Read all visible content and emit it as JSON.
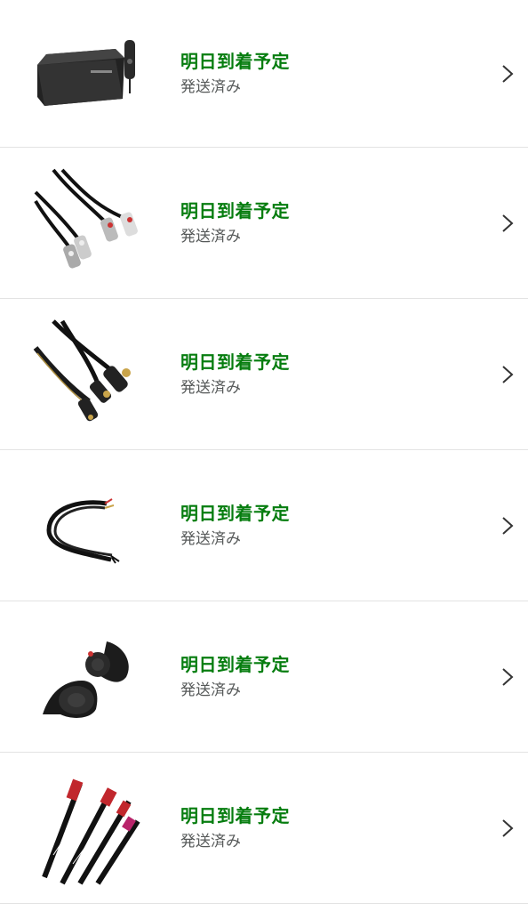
{
  "orders": [
    {
      "status": "明日到着予定",
      "sub": "発送済み",
      "image_icon": "amplifier-box-icon"
    },
    {
      "status": "明日到着予定",
      "sub": "発送済み",
      "image_icon": "rca-cable-icon"
    },
    {
      "status": "明日到着予定",
      "sub": "発送済み",
      "image_icon": "rca-splitter-cable-icon"
    },
    {
      "status": "明日到着予定",
      "sub": "発送済み",
      "image_icon": "wire-harness-icon"
    },
    {
      "status": "明日到着予定",
      "sub": "発送済み",
      "image_icon": "car-horn-icon"
    },
    {
      "status": "明日到着予定",
      "sub": "発送済み",
      "image_icon": "wiper-blades-icon"
    }
  ],
  "colors": {
    "status": "#067d0f",
    "sub": "#565959",
    "divider": "#e3e3e3",
    "chevron": "#333333"
  }
}
